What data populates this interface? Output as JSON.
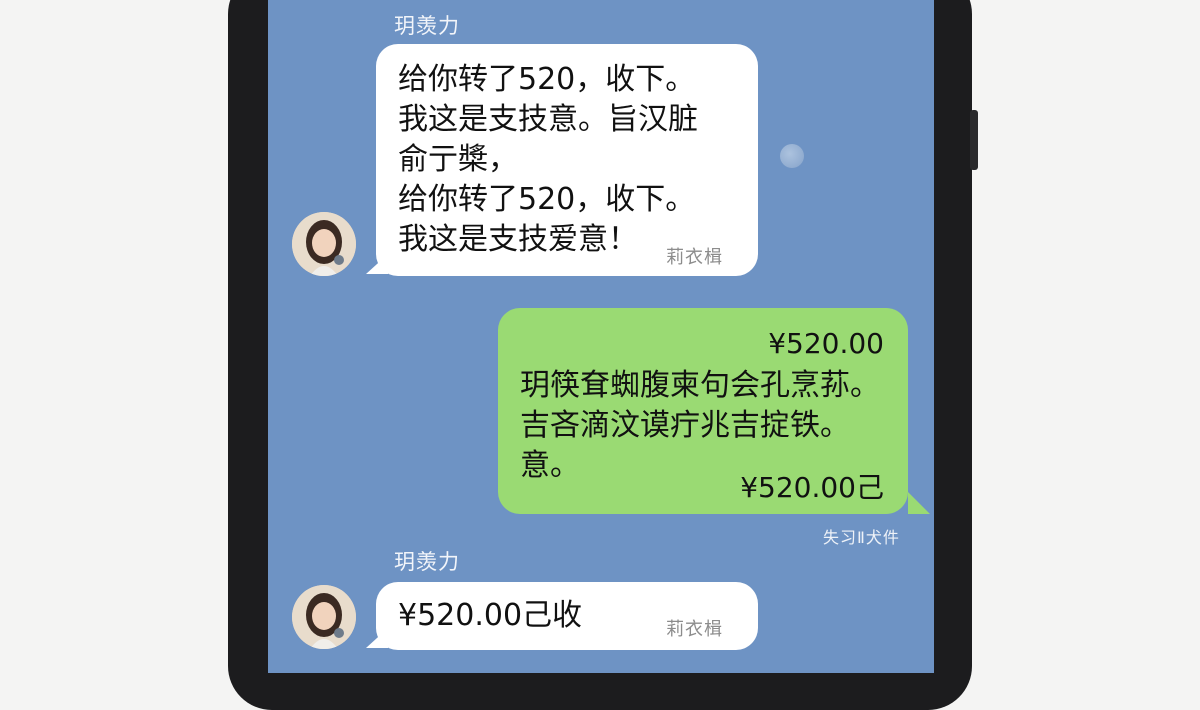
{
  "chat": {
    "messages": [
      {
        "sender": "玥羡力",
        "lines": [
          "给你转了520，收下。",
          "我这是支技意。旨汉脏",
          "俞亍槳，",
          "给你转了520，收下。",
          "我这是支技爱意！"
        ],
        "stamp": "莉衣楫"
      },
      {
        "amount_top": "¥520.00",
        "lines": [
          "玥筷耷蜘腹柬句会孔烹荪。",
          "吉吝滴汶谟疔兆吉掟铁。",
          "意。"
        ],
        "amount_bottom": "¥520.00己",
        "meta": "失习Ⅱ犬件"
      },
      {
        "sender": "玥羡力",
        "lines": [
          "¥520.00己收"
        ],
        "stamp": "莉衣楫"
      }
    ]
  },
  "colors": {
    "chat_background": "#6e93c4",
    "incoming_bubble": "#ffffff",
    "outgoing_bubble": "#9ada73",
    "phone_frame": "#1c1c1e"
  }
}
